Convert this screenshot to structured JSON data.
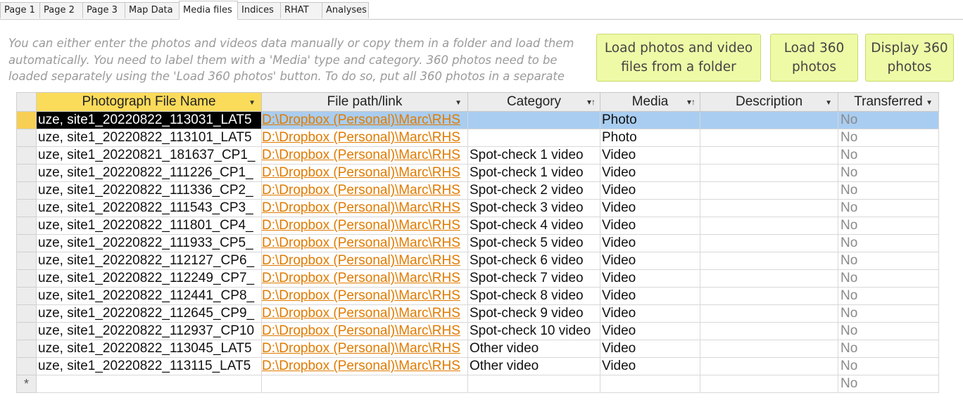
{
  "tabs": [
    {
      "label": "Page 1",
      "active": false
    },
    {
      "label": "Page 2",
      "active": false
    },
    {
      "label": "Page 3",
      "active": false
    },
    {
      "label": "Map Data",
      "active": false
    },
    {
      "label": "Media files",
      "active": true
    },
    {
      "label": "Indices",
      "active": false
    },
    {
      "label": "RHAT",
      "active": false
    },
    {
      "label": "Analyses",
      "active": false
    }
  ],
  "instructions": "You can either enter the photos and videos data manually or copy them in a folder and load them automatically. You need to label them with a 'Media' type and category. 360 photos need to be loaded separately using the 'Load 360 photos' button. To do so, put all 360 photos in a separate",
  "buttons": {
    "load_folder_line1": "Load photos and video",
    "load_folder_line2": "files from a folder",
    "load360_line1": "Load 360",
    "load360_line2": "photos",
    "display360_line1": "Display 360",
    "display360_line2": "photos"
  },
  "columns": [
    "Photograph File Name",
    "File path/link",
    "Category",
    "Media",
    "Description",
    "Transferred"
  ],
  "rows": [
    {
      "name": "uze, site1_20220822_113031_LAT5",
      "path": "D:\\Dropbox (Personal)\\Marc\\RHS",
      "category": "",
      "media": "Photo",
      "description": "",
      "transferred": "No"
    },
    {
      "name": "uze, site1_20220822_113101_LAT5",
      "path": "D:\\Dropbox (Personal)\\Marc\\RHS",
      "category": "",
      "media": "Photo",
      "description": "",
      "transferred": "No"
    },
    {
      "name": "uze, site1_20220821_181637_CP1_",
      "path": "D:\\Dropbox (Personal)\\Marc\\RHS",
      "category": "Spot-check 1 video",
      "media": "Video",
      "description": "",
      "transferred": "No"
    },
    {
      "name": "uze, site1_20220822_111226_CP1_",
      "path": "D:\\Dropbox (Personal)\\Marc\\RHS",
      "category": "Spot-check 1 video",
      "media": "Video",
      "description": "",
      "transferred": "No"
    },
    {
      "name": "uze, site1_20220822_111336_CP2_",
      "path": "D:\\Dropbox (Personal)\\Marc\\RHS",
      "category": "Spot-check 2 video",
      "media": "Video",
      "description": "",
      "transferred": "No"
    },
    {
      "name": "uze, site1_20220822_111543_CP3_",
      "path": "D:\\Dropbox (Personal)\\Marc\\RHS",
      "category": "Spot-check 3 video",
      "media": "Video",
      "description": "",
      "transferred": "No"
    },
    {
      "name": "uze, site1_20220822_111801_CP4_",
      "path": "D:\\Dropbox (Personal)\\Marc\\RHS",
      "category": "Spot-check 4 video",
      "media": "Video",
      "description": "",
      "transferred": "No"
    },
    {
      "name": "uze, site1_20220822_111933_CP5_",
      "path": "D:\\Dropbox (Personal)\\Marc\\RHS",
      "category": "Spot-check 5 video",
      "media": "Video",
      "description": "",
      "transferred": "No"
    },
    {
      "name": "uze, site1_20220822_112127_CP6_",
      "path": "D:\\Dropbox (Personal)\\Marc\\RHS",
      "category": "Spot-check 6 video",
      "media": "Video",
      "description": "",
      "transferred": "No"
    },
    {
      "name": "uze, site1_20220822_112249_CP7_",
      "path": "D:\\Dropbox (Personal)\\Marc\\RHS",
      "category": "Spot-check 7 video",
      "media": "Video",
      "description": "",
      "transferred": "No"
    },
    {
      "name": "uze, site1_20220822_112441_CP8_",
      "path": "D:\\Dropbox (Personal)\\Marc\\RHS",
      "category": "Spot-check 8 video",
      "media": "Video",
      "description": "",
      "transferred": "No"
    },
    {
      "name": "uze, site1_20220822_112645_CP9_",
      "path": "D:\\Dropbox (Personal)\\Marc\\RHS",
      "category": "Spot-check 9 video",
      "media": "Video",
      "description": "",
      "transferred": "No"
    },
    {
      "name": "uze, site1_20220822_112937_CP10",
      "path": "D:\\Dropbox (Personal)\\Marc\\RHS",
      "category": "Spot-check 10 video",
      "media": "Video",
      "description": "",
      "transferred": "No"
    },
    {
      "name": "uze, site1_20220822_113045_LAT5",
      "path": "D:\\Dropbox (Personal)\\Marc\\RHS",
      "category": "Other video",
      "media": "Video",
      "description": "",
      "transferred": "No"
    },
    {
      "name": "uze, site1_20220822_113115_LAT5",
      "path": "D:\\Dropbox (Personal)\\Marc\\RHS",
      "category": "Other video",
      "media": "Video",
      "description": "",
      "transferred": "No"
    }
  ],
  "new_row": {
    "marker": "*",
    "transferred": "No"
  },
  "colors": {
    "selected_header": "#fbdb5a",
    "current_row": "#a9cdf0",
    "button_bg": "#eefaa6",
    "link": "#e07b00"
  }
}
